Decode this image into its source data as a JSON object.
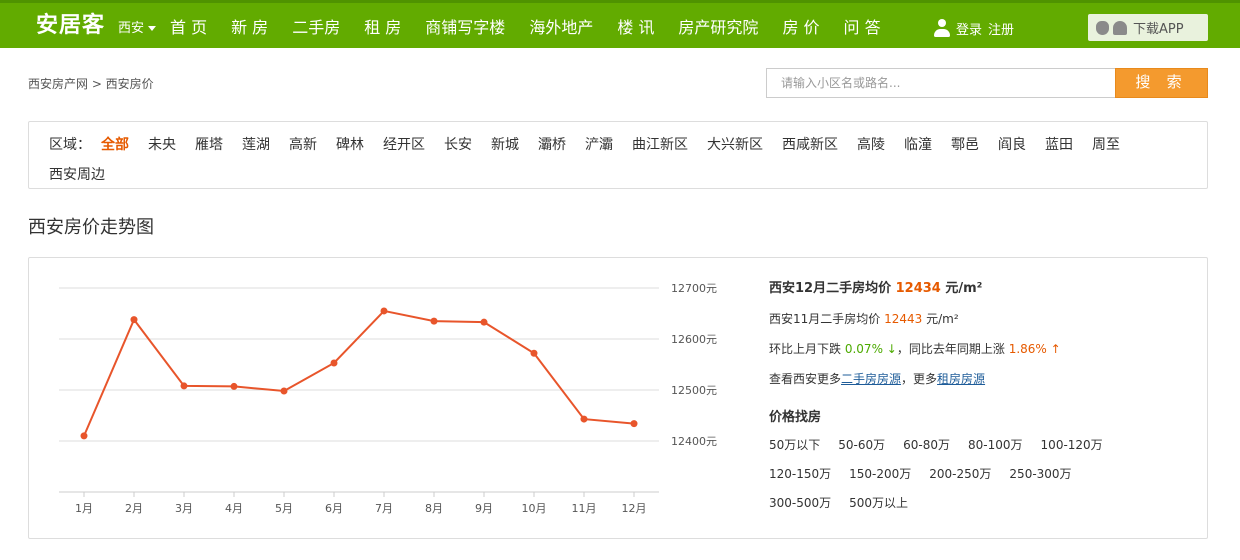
{
  "header": {
    "logo": "安居客",
    "city": "西安",
    "nav": [
      "首 页",
      "新 房",
      "二手房",
      "租 房",
      "商铺写字楼",
      "海外地产",
      "楼 讯",
      "房产研究院",
      "房 价",
      "问 答"
    ],
    "login": "登录",
    "register": "注册",
    "download": "下载APP"
  },
  "breadcrumb": "西安房产网 > 西安房价",
  "search": {
    "placeholder": "请输入小区名或路名...",
    "button": "搜 索"
  },
  "region": {
    "label": "区域：",
    "items": [
      "全部",
      "未央",
      "雁塔",
      "莲湖",
      "高新",
      "碑林",
      "经开区",
      "长安",
      "新城",
      "灞桥",
      "浐灞",
      "曲江新区",
      "大兴新区",
      "西咸新区",
      "高陵",
      "临潼",
      "鄠邑",
      "阎良",
      "蓝田",
      "周至",
      "西安周边"
    ],
    "active": 0
  },
  "section_title": "西安房价走势图",
  "chart_data": {
    "type": "line",
    "categories": [
      "1月",
      "2月",
      "3月",
      "4月",
      "5月",
      "6月",
      "7月",
      "8月",
      "9月",
      "10月",
      "11月",
      "12月"
    ],
    "series": [
      {
        "values": [
          12410,
          12638,
          12508,
          12507,
          12498,
          12553,
          12655,
          12635,
          12633,
          12572,
          12443,
          12434
        ],
        "color": "#e8552b"
      }
    ],
    "y_ticks": [
      "12400元",
      "12500元",
      "12600元",
      "12700元"
    ],
    "ylim": [
      12300,
      12700
    ],
    "grid": true
  },
  "info": {
    "l1_prefix": "西安12月二手房均价",
    "l1_value": "12434",
    "l1_unit": "元/m²",
    "l2_prefix": "西安11月二手房均价",
    "l2_value": "12443",
    "l2_unit": "元/m²",
    "l3_a": "环比上月下跌",
    "l3_b": "0.07% ↓",
    "l3_c": "，同比去年同期上涨",
    "l3_d": "1.86% ↑",
    "l4_a": "查看西安更多",
    "l4_link1": "二手房房源",
    "l4_b": "，更多",
    "l4_link2": "租房房源",
    "price_title": "价格找房",
    "price_ranges": [
      "50万以下",
      "50-60万",
      "60-80万",
      "80-100万",
      "100-120万",
      "120-150万",
      "150-200万",
      "200-250万",
      "250-300万",
      "300-500万",
      "500万以上"
    ]
  }
}
